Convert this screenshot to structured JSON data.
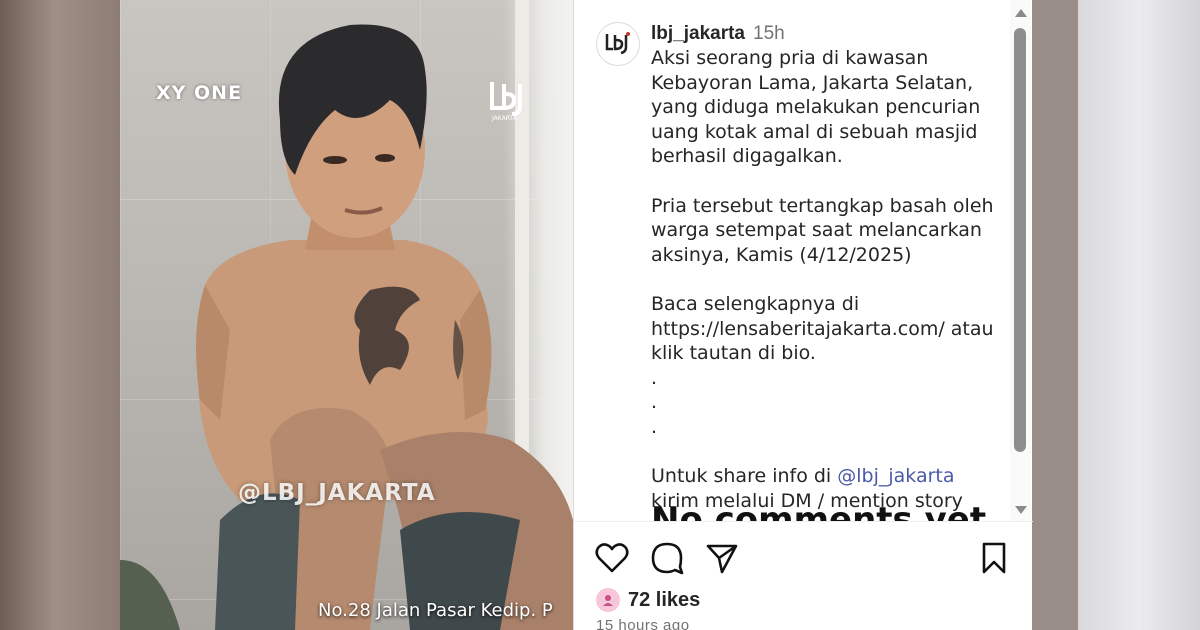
{
  "media": {
    "watermark_brand": "XY ONE",
    "watermark_handle": "@LBJ_JAKARTA",
    "location_caption": "No.28 Jalan Pasar Kedip. P",
    "logo_text": "LBJ",
    "logo_subtext": "JAKARTA"
  },
  "post": {
    "username": "lbj_jakarta",
    "time_ago": "15h",
    "caption_lines": [
      "Aksi seorang pria di kawasan Kebayoran Lama, Jakarta Selatan, yang diduga melakukan pencurian uang kotak amal di sebuah masjid berhasil digagalkan.",
      "Pria tersebut tertangkap basah oleh warga setempat saat melancarkan aksinya, Kamis (4/12/2025)",
      "Baca selengkapnya di https://lensaberitajakarta.com/ atau klik tautan di bio."
    ],
    "dots": ".\n.\n.",
    "share_prefix": "Untuk share info di ",
    "share_mention": "@lbj_jakarta",
    "share_suffix": " kirim melalui DM / mention story",
    "no_comments": "No comments yet."
  },
  "actions": {
    "icons": [
      "heart-icon",
      "comment-icon",
      "share-icon",
      "bookmark-icon"
    ],
    "likes": "72 likes",
    "posted_ago": "15 hours ago"
  },
  "colors": {
    "mention": "#4a5aa7",
    "text": "#262626",
    "muted": "#737373"
  }
}
